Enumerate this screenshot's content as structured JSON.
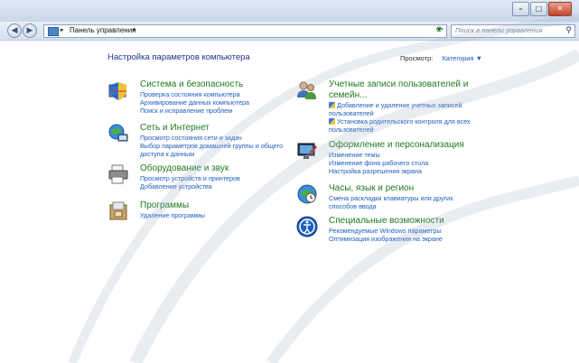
{
  "window": {
    "buttons": [
      "–",
      "□",
      "✕"
    ]
  },
  "nav": {
    "back_icon": "back-arrow-icon",
    "forward_icon": "forward-arrow-icon",
    "breadcrumb": "Панель управления",
    "breadcrumb_sep": "▸",
    "search_placeholder": "Поиск в панели управления"
  },
  "header": {
    "title": "Настройка параметров компьютера",
    "view_label": "Просмотр:",
    "view_value": "Категория ▼"
  },
  "left": [
    {
      "title": "Система и безопасность",
      "icon": "shield-computer-icon",
      "links": [
        "Проверка состояния компьютера",
        "Архивирование данных компьютера",
        "Поиск и исправление проблем"
      ]
    },
    {
      "title": "Сеть и Интернет",
      "icon": "network-globe-icon",
      "links": [
        "Просмотр состояния сети и задач",
        "Выбор параметров домашней группы и общего",
        "доступа к данным"
      ]
    },
    {
      "title": "Оборудование и звук",
      "icon": "printer-icon",
      "links": [
        "Просмотр устройств и принтеров",
        "Добавление устройства"
      ]
    },
    {
      "title": "Программы",
      "icon": "programs-box-icon",
      "links": [
        "Удаление программы"
      ]
    }
  ],
  "right": [
    {
      "title": "Учетные записи пользователей и",
      "title2": "семейн...",
      "icon": "users-icon",
      "links": [
        {
          "text": "Добавление и удаление учетных записей",
          "shield": true
        },
        {
          "text": "пользователей",
          "shield": false
        },
        {
          "text": "Установка родительского контроля для всех",
          "shield": true
        },
        {
          "text": "пользователей",
          "shield": false
        }
      ]
    },
    {
      "title": "Оформление и персонализация",
      "icon": "monitor-paint-icon",
      "links": [
        {
          "text": "Изменение темы",
          "shield": false
        },
        {
          "text": "Изменение фона рабочего стола",
          "shield": false
        },
        {
          "text": "Настройка разрешения экрана",
          "shield": false
        }
      ]
    },
    {
      "title": "Часы, язык и регион",
      "icon": "clock-globe-icon",
      "links": [
        {
          "text": "Смена раскладки клавиатуры или других",
          "shield": false
        },
        {
          "text": "способов ввода",
          "shield": false
        }
      ]
    },
    {
      "title": "Специальные возможности",
      "icon": "accessibility-icon",
      "links": [
        {
          "text": "Рекомендуемые Windows параметры",
          "shield": false
        },
        {
          "text": "Оптимизация изображения на экране",
          "shield": false
        }
      ]
    }
  ]
}
